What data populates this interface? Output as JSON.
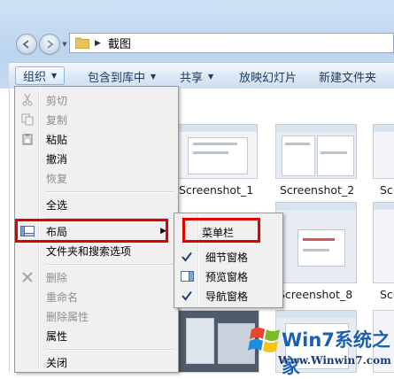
{
  "address": {
    "crumb": "截图"
  },
  "toolbar": {
    "organize": "组织",
    "include_in_library": "包含到库中",
    "share": "共享",
    "slideshow": "放映幻灯片",
    "new_folder": "新建文件夹"
  },
  "files": [
    {
      "name": "Screenshot_1"
    },
    {
      "name": "Screenshot_2"
    },
    {
      "name": "Scr"
    },
    {
      "name": "Screenshot_8"
    },
    {
      "name": "Scr"
    }
  ],
  "organize_menu": {
    "items": [
      {
        "label": "剪切",
        "enabled": false,
        "icon": "scissors-icon"
      },
      {
        "label": "复制",
        "enabled": false,
        "icon": "copy-icon"
      },
      {
        "label": "粘贴",
        "enabled": true,
        "icon": "paste-icon"
      },
      {
        "label": "撤消",
        "enabled": true
      },
      {
        "label": "恢复",
        "enabled": false
      },
      {
        "label": "全选",
        "enabled": true
      },
      {
        "label": "布局",
        "enabled": true,
        "icon": "layout-icon",
        "has_submenu": true
      },
      {
        "label": "文件夹和搜索选项",
        "enabled": true
      },
      {
        "label": "删除",
        "enabled": false,
        "icon": "delete-x-icon"
      },
      {
        "label": "重命名",
        "enabled": false
      },
      {
        "label": "删除属性",
        "enabled": false
      },
      {
        "label": "属性",
        "enabled": true
      },
      {
        "label": "关闭",
        "enabled": true
      }
    ]
  },
  "layout_submenu": {
    "items": [
      {
        "label": "菜单栏",
        "checked": false
      },
      {
        "label": "细节窗格",
        "checked": true
      },
      {
        "label": "预览窗格",
        "checked": false,
        "icon": "preview-pane-icon"
      },
      {
        "label": "导航窗格",
        "checked": true
      }
    ]
  },
  "watermark": {
    "brand": "Win7系统之家",
    "url": "Www.Winwin7.com"
  },
  "colors": {
    "highlight": "#e00000",
    "accent": "#1a5fb4"
  }
}
